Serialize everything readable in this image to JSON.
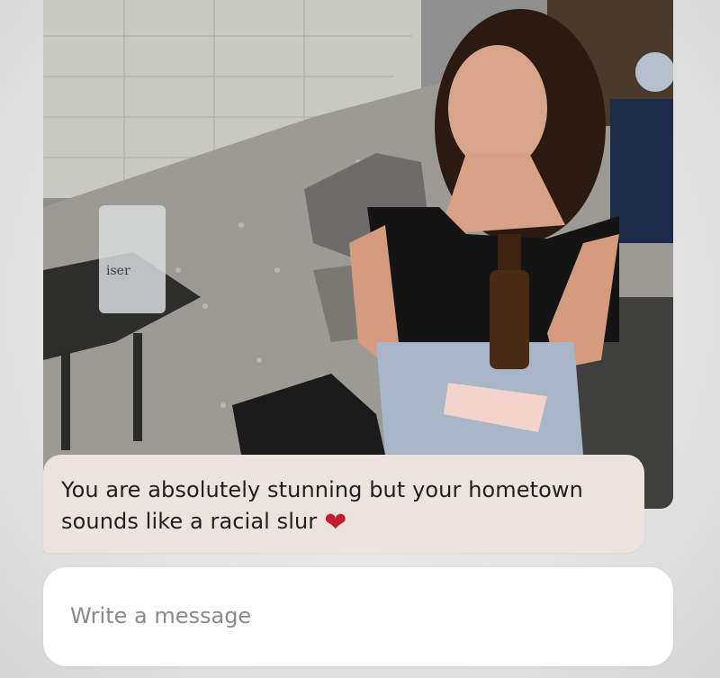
{
  "photo": {
    "alt": "",
    "glass_text": "iser"
  },
  "message": {
    "text": "You are absolutely stunning but your hometown\nsounds like a racial slur",
    "reaction": "❤",
    "reaction_icon": "heart-icon",
    "bubble_color": "#ece3df"
  },
  "composer": {
    "placeholder": "Write a message",
    "value": ""
  },
  "colors": {
    "background": "#e6e6e6",
    "composer_bg": "#ffffff",
    "heart": "#c51e2a"
  }
}
